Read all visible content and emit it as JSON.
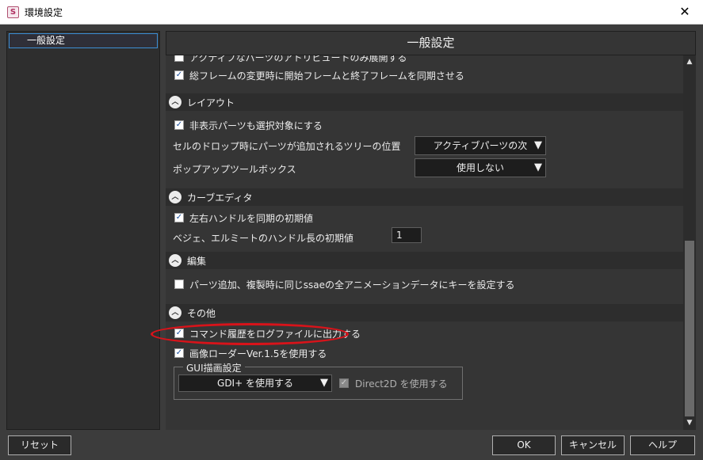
{
  "window": {
    "title": "環境設定",
    "app_icon_letter": "S",
    "close_glyph": "✕"
  },
  "tree": {
    "items": [
      {
        "label": "一般設定",
        "selected": true
      }
    ]
  },
  "header": {
    "title": "一般設定"
  },
  "top_rows": [
    {
      "label": "アクティブなパーツのアトリビュートのみ展開する",
      "checked": false
    },
    {
      "label": "総フレームの変更時に開始フレームと終了フレームを同期させる",
      "checked": true
    }
  ],
  "sections": {
    "layout": {
      "title": "レイアウト",
      "checkbox_label": "非表示パーツも選択対象にする",
      "checked": true,
      "drop_label": "セルのドロップ時にパーツが追加されるツリーの位置",
      "drop_value": "アクティブパーツの次",
      "popup_label": "ポップアップツールボックス",
      "popup_value": "使用しない"
    },
    "curve_editor": {
      "title": "カーブエディタ",
      "checkbox_label": "左右ハンドルを同期の初期値",
      "checked": true,
      "handle_label": "ベジェ、エルミートのハンドル長の初期値",
      "handle_value": "1"
    },
    "edit": {
      "title": "編集",
      "checkbox_label": "パーツ追加、複製時に同じssaeの全アニメーションデータにキーを設定する",
      "checked": false
    },
    "other": {
      "title": "その他",
      "log_label": "コマンド履歴をログファイルに出力する",
      "log_checked": true,
      "loader_label": "画像ローダーVer.1.5を使用する",
      "loader_checked": true,
      "gui_group_title": "GUI描画設定",
      "gui_select_value": "GDI+ を使用する",
      "direct2d_label": "Direct2D を使用する",
      "direct2d_checked": true
    }
  },
  "icons": {
    "collapse": "︿",
    "dropdown": "▼",
    "check": "✓",
    "scroll_up": "▲",
    "scroll_down": "▼"
  },
  "buttons": {
    "reset": "リセット",
    "ok": "OK",
    "cancel": "キャンセル",
    "help": "ヘルプ"
  },
  "colors": {
    "highlight_oval": "#d8131a",
    "selection_border": "#3d8fd6"
  }
}
